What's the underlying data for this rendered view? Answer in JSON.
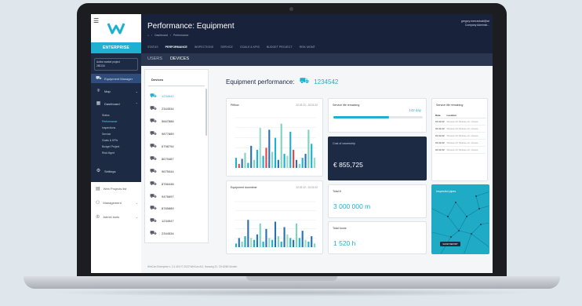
{
  "sidebar": {
    "enterprise_label": "ENTERPRISE",
    "project_label": "Active market project",
    "project_value": "280134",
    "items": [
      {
        "label": "Equipment Manager",
        "icon": "truck-icon",
        "active": true
      },
      {
        "label": "Map",
        "icon": "map-pin-icon"
      },
      {
        "label": "Dashboard",
        "icon": "dashboard-icon"
      }
    ],
    "dashboard_sub": [
      "Status",
      "Performance",
      "Inspections",
      "Service",
      "Goals & KPIs",
      "Budget Project",
      "Risk Mgmt"
    ],
    "settings_label": "Settings",
    "light_items": [
      {
        "label": "Web Projects list",
        "icon": "list-icon"
      },
      {
        "label": "Management",
        "icon": "users-icon"
      },
      {
        "label": "Admin tools",
        "icon": "crown-icon"
      }
    ]
  },
  "header": {
    "title": "Performance: Equipment",
    "breadcrumb": [
      "⌂",
      "Dashboard",
      "Performance"
    ],
    "user_email": "gregory.meeuwbald@wi",
    "user_role": "Company Administ...",
    "tabs": [
      "STATUS",
      "PERFORMANCE",
      "INSPECTIONS",
      "SERVICE",
      "GOALS & KPIS",
      "BUDGET PROJECT",
      "RISK MGMT"
    ],
    "active_tab": "PERFORMANCE"
  },
  "subtabs": [
    "USERS",
    "DEVICES"
  ],
  "devices": {
    "heading": "Devices",
    "list": [
      "1234542",
      "2344534",
      "5667888",
      "9877889",
      "6798754",
      "8679487",
      "9675044",
      "8766448",
      "9476697",
      "8765889",
      "1234547",
      "2344534"
    ]
  },
  "main": {
    "title_prefix": "Equipment performance:",
    "equipment_id": "1234542"
  },
  "cards": {
    "pitflow_title": "Pitflow",
    "pitflow_date": "22.02.22 - 24.02.22",
    "downtime_title": "Equipment downtime",
    "downtime_date": "22.02.22 - 24.02.22",
    "life_title": "Service life remaining",
    "life_value": "142 day",
    "life_fraction": 0.62,
    "tco_title": "Cost of ownership",
    "tco_value": "€ 855,725",
    "ft_title": "Total ft",
    "ft_value": "3 000 000 m",
    "hours_title": "Total hours",
    "hours_value": "1 520 h",
    "service_title": "Service life remaining",
    "service_cols": [
      "Date",
      "Location"
    ],
    "service_rows": [
      [
        "01.02.22",
        "Strasse 23 Strasse str. streets"
      ],
      [
        "01.02.22",
        "Strasse 23 Strasse str. streets"
      ],
      [
        "01.02.22",
        "Strasse 23 Strasse str. streets"
      ],
      [
        "01.02.22",
        "Strasse 23 Strasse str. streets"
      ],
      [
        "01.02.22",
        "Strasse 23 Strasse str. streets"
      ]
    ],
    "pipes_title": "Inspected pipes",
    "pipes_button": "SHOW REPORT"
  },
  "footer": "WinCan Enterprise v. 2.2.40.0 © 2022 WinCan AG, Hauweg 22, CH-8280 Murten",
  "colors": {
    "accent": "#1eb0d0",
    "navy": "#1d2a44",
    "red": "#e04848"
  },
  "chart_data": [
    {
      "type": "bar",
      "title": "Pitflow",
      "series": [
        {
          "values": [
            10,
            4,
            9,
            15,
            5,
            22,
            8,
            18,
            40,
            12,
            20,
            38,
            16,
            30,
            8,
            44,
            14,
            12,
            36,
            18,
            8,
            4,
            10,
            14,
            38,
            24,
            10
          ]
        }
      ]
    },
    {
      "type": "bar",
      "title": "Equipment downtime",
      "series": [
        {
          "values": [
            4,
            10,
            6,
            12,
            30,
            10,
            8,
            14,
            26,
            6,
            20,
            10,
            8,
            28,
            12,
            6,
            22,
            14,
            10,
            8,
            26,
            10,
            18,
            8,
            6,
            12,
            4
          ]
        }
      ]
    }
  ]
}
